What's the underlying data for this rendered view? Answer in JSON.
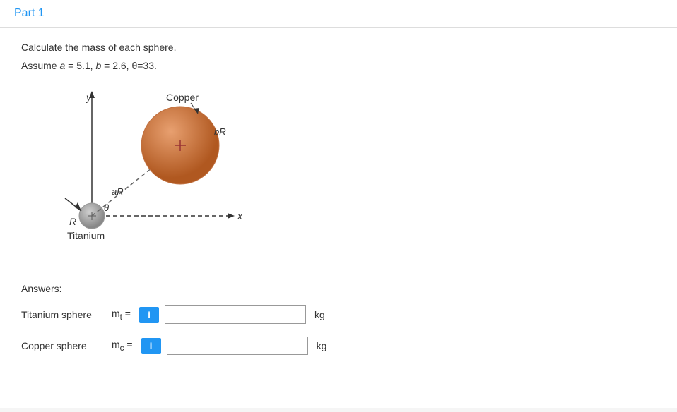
{
  "header": {
    "title": "Part 1"
  },
  "problem": {
    "instruction": "Calculate the mass of each sphere.",
    "assumption": "Assume a = 5.1, b = 2.6, θ=33.",
    "diagram": {
      "copper_label": "Copper",
      "titanium_label": "Titanium",
      "aR_label": "aR",
      "bR_label": "bR",
      "y_label": "y",
      "x_label": "x",
      "R_label": "R",
      "theta_label": "θ"
    }
  },
  "answers": {
    "section_label": "Answers:",
    "titanium": {
      "sphere_label": "Titanium sphere",
      "var_label": "mₜ =",
      "info_label": "i",
      "unit": "kg",
      "placeholder": ""
    },
    "copper": {
      "sphere_label": "Copper sphere",
      "var_label": "mc =",
      "info_label": "i",
      "unit": "kg",
      "placeholder": ""
    }
  }
}
